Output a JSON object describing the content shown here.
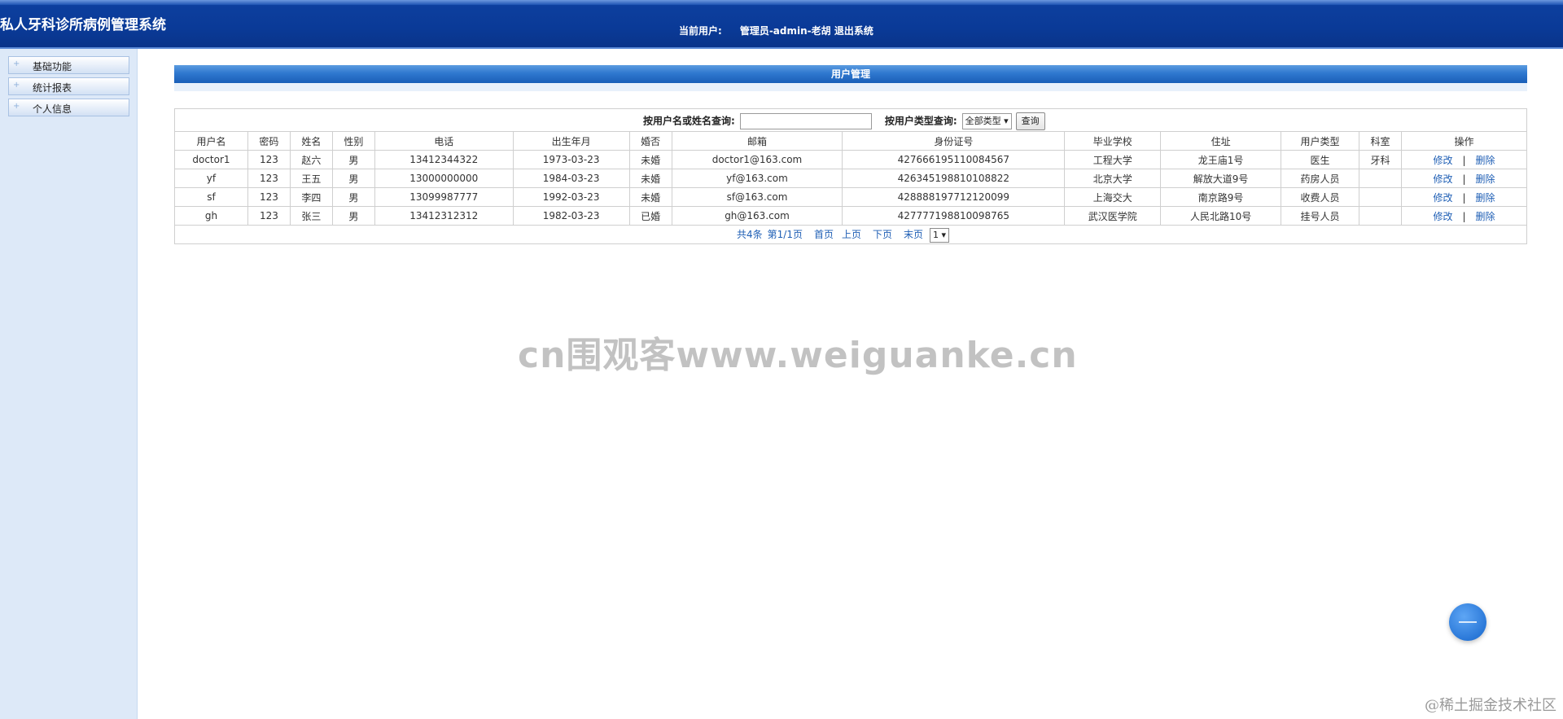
{
  "header": {
    "app_title": "私人牙科诊所病例管理系统",
    "current_user_label": "当前用户:",
    "current_user": "管理员-admin-老胡",
    "logout": "退出系统"
  },
  "sidebar": {
    "items": [
      {
        "label": "基础功能"
      },
      {
        "label": "统计报表"
      },
      {
        "label": "个人信息"
      }
    ]
  },
  "panel": {
    "title": "用户管理"
  },
  "search": {
    "name_label": "按用户名或姓名查询:",
    "name_value": "",
    "type_label": "按用户类型查询:",
    "type_selected": "全部类型",
    "button": "查询"
  },
  "table": {
    "headers": [
      "用户名",
      "密码",
      "姓名",
      "性别",
      "电话",
      "出生年月",
      "婚否",
      "邮箱",
      "身份证号",
      "毕业学校",
      "住址",
      "用户类型",
      "科室",
      "操作"
    ],
    "rows": [
      {
        "username": "doctor1",
        "password": "123",
        "name": "赵六",
        "gender": "男",
        "phone": "13412344322",
        "birth": "1973-03-23",
        "married": "未婚",
        "email": "doctor1@163.com",
        "id_card": "427666195110084567",
        "school": "工程大学",
        "address": "龙王庙1号",
        "type": "医生",
        "dept": "牙科",
        "edit": "修改",
        "sep": "|",
        "delete": "删除"
      },
      {
        "username": "yf",
        "password": "123",
        "name": "王五",
        "gender": "男",
        "phone": "13000000000",
        "birth": "1984-03-23",
        "married": "未婚",
        "email": "yf@163.com",
        "id_card": "426345198810108822",
        "school": "北京大学",
        "address": "解放大道9号",
        "type": "药房人员",
        "dept": "",
        "edit": "修改",
        "sep": "|",
        "delete": "删除"
      },
      {
        "username": "sf",
        "password": "123",
        "name": "李四",
        "gender": "男",
        "phone": "13099987777",
        "birth": "1992-03-23",
        "married": "未婚",
        "email": "sf@163.com",
        "id_card": "428888197712120099",
        "school": "上海交大",
        "address": "南京路9号",
        "type": "收费人员",
        "dept": "",
        "edit": "修改",
        "sep": "|",
        "delete": "删除"
      },
      {
        "username": "gh",
        "password": "123",
        "name": "张三",
        "gender": "男",
        "phone": "13412312312",
        "birth": "1982-03-23",
        "married": "已婚",
        "email": "gh@163.com",
        "id_card": "427777198810098765",
        "school": "武汉医学院",
        "address": "人民北路10号",
        "type": "挂号人员",
        "dept": "",
        "edit": "修改",
        "sep": "|",
        "delete": "删除"
      }
    ]
  },
  "pager": {
    "total": "共4条",
    "page_info": "第1/1页",
    "first": "首页",
    "prev": "上页",
    "next": "下页",
    "last": "末页",
    "page_select": "1 ▾"
  },
  "watermark": "cn围观客www.weiguanke.cn",
  "corner_mark": "@稀土掘金技术社区"
}
